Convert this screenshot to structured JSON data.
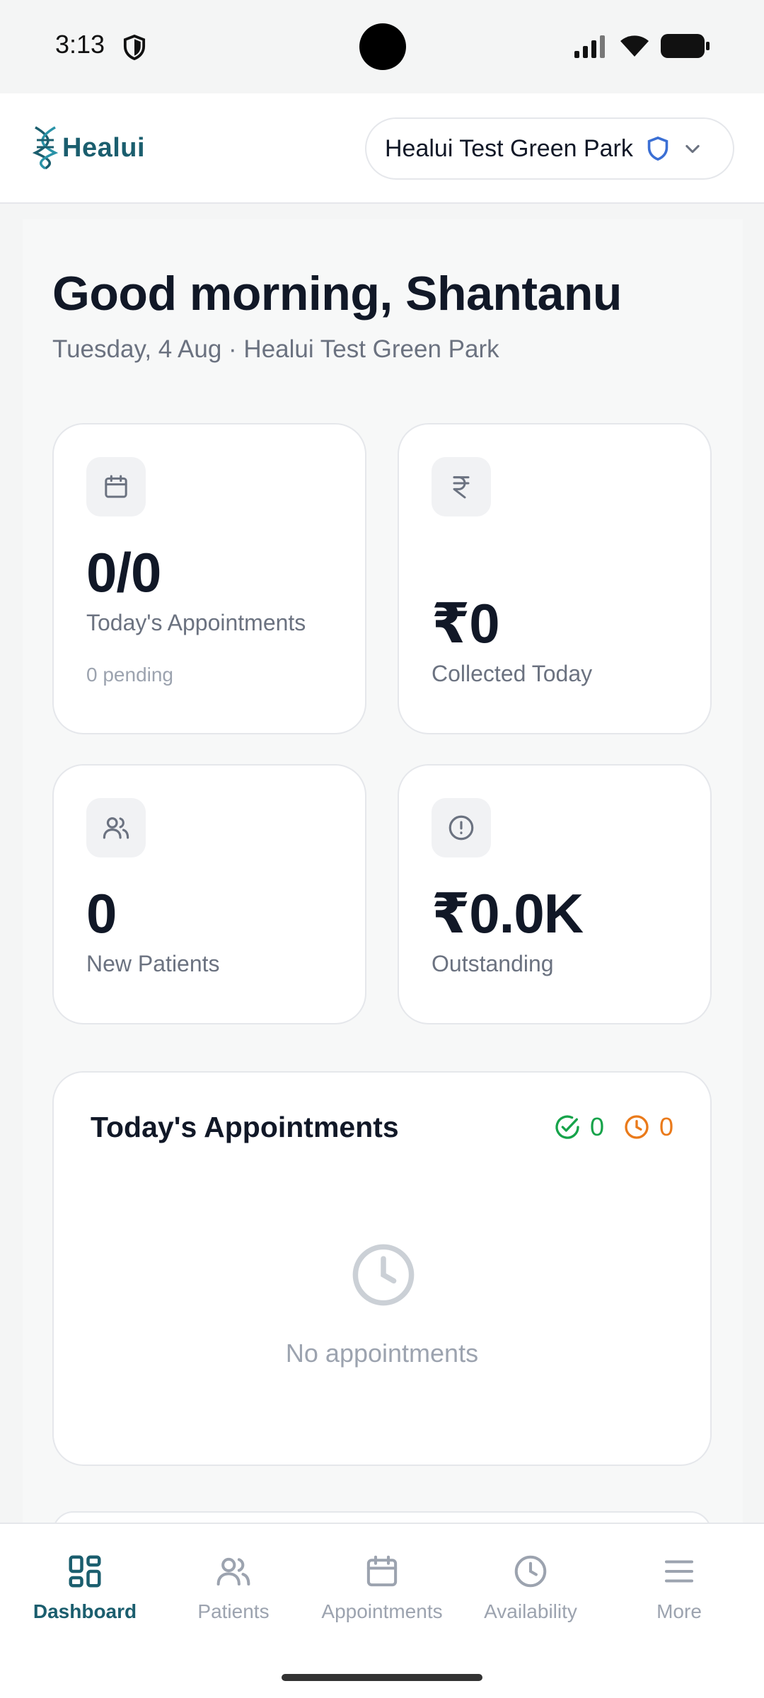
{
  "status_bar": {
    "time": "3:13"
  },
  "header": {
    "logo_text": "Healui",
    "clinic_name": "Healui Test Green Park"
  },
  "greeting": {
    "title": "Good morning, Shantanu",
    "subtitle": "Tuesday, 4 Aug · Healui Test Green Park"
  },
  "stats": {
    "appointments": {
      "value": "0/0",
      "label": "Today's Appointments",
      "sub": "0 pending",
      "icon": "calendar-icon"
    },
    "collected": {
      "value": "₹0",
      "label": "Collected Today",
      "icon": "rupee-icon"
    },
    "new_patients": {
      "value": "0",
      "label": "New Patients",
      "icon": "users-icon"
    },
    "outstanding": {
      "value": "₹0.0K",
      "label": "Outstanding",
      "icon": "alert-circle-icon"
    }
  },
  "todays_appointments": {
    "title": "Today's Appointments",
    "completed_count": "0",
    "pending_count": "0",
    "empty_text": "No appointments"
  },
  "nav": {
    "items": [
      {
        "label": "Dashboard",
        "icon": "grid-icon",
        "active": true
      },
      {
        "label": "Patients",
        "icon": "users-icon"
      },
      {
        "label": "Appointments",
        "icon": "calendar-icon"
      },
      {
        "label": "Availability",
        "icon": "clock-icon"
      },
      {
        "label": "More",
        "icon": "menu-icon"
      }
    ]
  },
  "colors": {
    "brand": "#1b5e6e",
    "completed": "#16a34a",
    "pending": "#ea7a1a",
    "shield_blue": "#3b6fd4"
  }
}
